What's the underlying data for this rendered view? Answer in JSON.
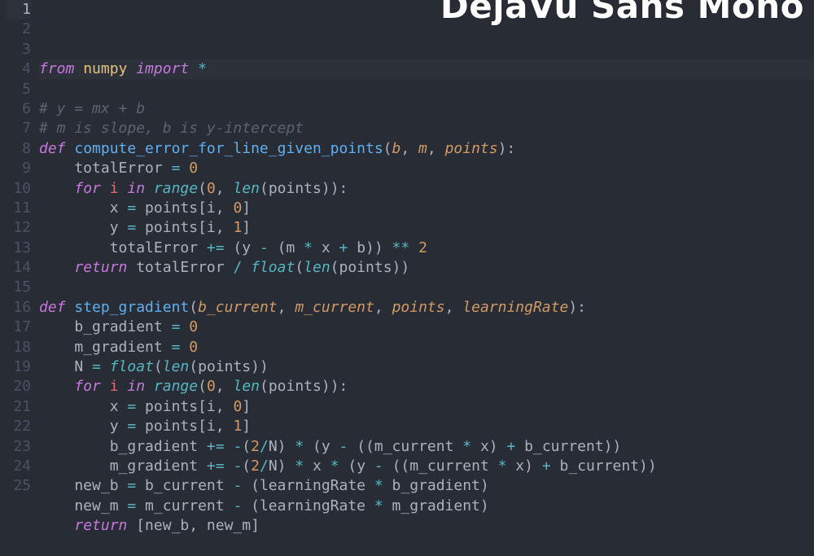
{
  "title_overlay": "DejaVu Sans Mono",
  "current_line": 1,
  "lines": [
    {
      "n": 1,
      "tokens": [
        {
          "t": "from ",
          "c": "kw"
        },
        {
          "t": "numpy",
          "c": "mod"
        },
        {
          "t": " ",
          "c": "txt"
        },
        {
          "t": "import",
          "c": "kw"
        },
        {
          "t": " ",
          "c": "txt"
        },
        {
          "t": "*",
          "c": "op"
        }
      ]
    },
    {
      "n": 2,
      "tokens": [
        {
          "t": "",
          "c": "txt"
        }
      ]
    },
    {
      "n": 3,
      "tokens": [
        {
          "t": "# y = mx + b",
          "c": "cmt"
        }
      ]
    },
    {
      "n": 4,
      "tokens": [
        {
          "t": "# m is slope, b is y-intercept",
          "c": "cmt"
        }
      ]
    },
    {
      "n": 5,
      "tokens": [
        {
          "t": "def ",
          "c": "kw"
        },
        {
          "t": "compute_error_for_line_given_points",
          "c": "def"
        },
        {
          "t": "(",
          "c": "txt"
        },
        {
          "t": "b",
          "c": "prm"
        },
        {
          "t": ", ",
          "c": "txt"
        },
        {
          "t": "m",
          "c": "prm"
        },
        {
          "t": ", ",
          "c": "txt"
        },
        {
          "t": "points",
          "c": "prm"
        },
        {
          "t": "):",
          "c": "txt"
        }
      ]
    },
    {
      "n": 6,
      "tokens": [
        {
          "t": "    totalError ",
          "c": "txt"
        },
        {
          "t": "=",
          "c": "op"
        },
        {
          "t": " ",
          "c": "txt"
        },
        {
          "t": "0",
          "c": "num"
        }
      ]
    },
    {
      "n": 7,
      "tokens": [
        {
          "t": "    ",
          "c": "txt"
        },
        {
          "t": "for ",
          "c": "kw"
        },
        {
          "t": "i",
          "c": "w"
        },
        {
          "t": " ",
          "c": "txt"
        },
        {
          "t": "in ",
          "c": "kw"
        },
        {
          "t": "range",
          "c": "bi"
        },
        {
          "t": "(",
          "c": "txt"
        },
        {
          "t": "0",
          "c": "num"
        },
        {
          "t": ", ",
          "c": "txt"
        },
        {
          "t": "len",
          "c": "bi"
        },
        {
          "t": "(points)):",
          "c": "txt"
        }
      ]
    },
    {
      "n": 8,
      "tokens": [
        {
          "t": "        x ",
          "c": "txt"
        },
        {
          "t": "=",
          "c": "op"
        },
        {
          "t": " points[i, ",
          "c": "txt"
        },
        {
          "t": "0",
          "c": "num"
        },
        {
          "t": "]",
          "c": "txt"
        }
      ]
    },
    {
      "n": 9,
      "tokens": [
        {
          "t": "        y ",
          "c": "txt"
        },
        {
          "t": "=",
          "c": "op"
        },
        {
          "t": " points[i, ",
          "c": "txt"
        },
        {
          "t": "1",
          "c": "num"
        },
        {
          "t": "]",
          "c": "txt"
        }
      ]
    },
    {
      "n": 10,
      "tokens": [
        {
          "t": "        totalError ",
          "c": "txt"
        },
        {
          "t": "+=",
          "c": "op"
        },
        {
          "t": " (y ",
          "c": "txt"
        },
        {
          "t": "-",
          "c": "op"
        },
        {
          "t": " (m ",
          "c": "txt"
        },
        {
          "t": "*",
          "c": "op"
        },
        {
          "t": " x ",
          "c": "txt"
        },
        {
          "t": "+",
          "c": "op"
        },
        {
          "t": " b)) ",
          "c": "txt"
        },
        {
          "t": "**",
          "c": "op"
        },
        {
          "t": " ",
          "c": "txt"
        },
        {
          "t": "2",
          "c": "num"
        }
      ]
    },
    {
      "n": 11,
      "tokens": [
        {
          "t": "    ",
          "c": "txt"
        },
        {
          "t": "return ",
          "c": "kw"
        },
        {
          "t": "totalError ",
          "c": "txt"
        },
        {
          "t": "/",
          "c": "op"
        },
        {
          "t": " ",
          "c": "txt"
        },
        {
          "t": "float",
          "c": "bi"
        },
        {
          "t": "(",
          "c": "txt"
        },
        {
          "t": "len",
          "c": "bi"
        },
        {
          "t": "(points))",
          "c": "txt"
        }
      ]
    },
    {
      "n": 12,
      "tokens": [
        {
          "t": "",
          "c": "txt"
        }
      ]
    },
    {
      "n": 13,
      "tokens": [
        {
          "t": "def ",
          "c": "kw"
        },
        {
          "t": "step_gradient",
          "c": "def"
        },
        {
          "t": "(",
          "c": "txt"
        },
        {
          "t": "b_current",
          "c": "prm"
        },
        {
          "t": ", ",
          "c": "txt"
        },
        {
          "t": "m_current",
          "c": "prm"
        },
        {
          "t": ", ",
          "c": "txt"
        },
        {
          "t": "points",
          "c": "prm"
        },
        {
          "t": ", ",
          "c": "txt"
        },
        {
          "t": "learningRate",
          "c": "prm"
        },
        {
          "t": "):",
          "c": "txt"
        }
      ]
    },
    {
      "n": 14,
      "tokens": [
        {
          "t": "    b_gradient ",
          "c": "txt"
        },
        {
          "t": "=",
          "c": "op"
        },
        {
          "t": " ",
          "c": "txt"
        },
        {
          "t": "0",
          "c": "num"
        }
      ]
    },
    {
      "n": 15,
      "tokens": [
        {
          "t": "    m_gradient ",
          "c": "txt"
        },
        {
          "t": "=",
          "c": "op"
        },
        {
          "t": " ",
          "c": "txt"
        },
        {
          "t": "0",
          "c": "num"
        }
      ]
    },
    {
      "n": 16,
      "tokens": [
        {
          "t": "    N ",
          "c": "txt"
        },
        {
          "t": "=",
          "c": "op"
        },
        {
          "t": " ",
          "c": "txt"
        },
        {
          "t": "float",
          "c": "bi"
        },
        {
          "t": "(",
          "c": "txt"
        },
        {
          "t": "len",
          "c": "bi"
        },
        {
          "t": "(points))",
          "c": "txt"
        }
      ]
    },
    {
      "n": 17,
      "tokens": [
        {
          "t": "    ",
          "c": "txt"
        },
        {
          "t": "for ",
          "c": "kw"
        },
        {
          "t": "i",
          "c": "w"
        },
        {
          "t": " ",
          "c": "txt"
        },
        {
          "t": "in ",
          "c": "kw"
        },
        {
          "t": "range",
          "c": "bi"
        },
        {
          "t": "(",
          "c": "txt"
        },
        {
          "t": "0",
          "c": "num"
        },
        {
          "t": ", ",
          "c": "txt"
        },
        {
          "t": "len",
          "c": "bi"
        },
        {
          "t": "(points)):",
          "c": "txt"
        }
      ]
    },
    {
      "n": 18,
      "tokens": [
        {
          "t": "        x ",
          "c": "txt"
        },
        {
          "t": "=",
          "c": "op"
        },
        {
          "t": " points[i, ",
          "c": "txt"
        },
        {
          "t": "0",
          "c": "num"
        },
        {
          "t": "]",
          "c": "txt"
        }
      ]
    },
    {
      "n": 19,
      "tokens": [
        {
          "t": "        y ",
          "c": "txt"
        },
        {
          "t": "=",
          "c": "op"
        },
        {
          "t": " points[i, ",
          "c": "txt"
        },
        {
          "t": "1",
          "c": "num"
        },
        {
          "t": "]",
          "c": "txt"
        }
      ]
    },
    {
      "n": 20,
      "tokens": [
        {
          "t": "        b_gradient ",
          "c": "txt"
        },
        {
          "t": "+=",
          "c": "op"
        },
        {
          "t": " ",
          "c": "txt"
        },
        {
          "t": "-",
          "c": "op"
        },
        {
          "t": "(",
          "c": "txt"
        },
        {
          "t": "2",
          "c": "num"
        },
        {
          "t": "/",
          "c": "op"
        },
        {
          "t": "N) ",
          "c": "txt"
        },
        {
          "t": "*",
          "c": "op"
        },
        {
          "t": " (y ",
          "c": "txt"
        },
        {
          "t": "-",
          "c": "op"
        },
        {
          "t": " ((m_current ",
          "c": "txt"
        },
        {
          "t": "*",
          "c": "op"
        },
        {
          "t": " x) ",
          "c": "txt"
        },
        {
          "t": "+",
          "c": "op"
        },
        {
          "t": " b_current))",
          "c": "txt"
        }
      ]
    },
    {
      "n": 21,
      "tokens": [
        {
          "t": "        m_gradient ",
          "c": "txt"
        },
        {
          "t": "+=",
          "c": "op"
        },
        {
          "t": " ",
          "c": "txt"
        },
        {
          "t": "-",
          "c": "op"
        },
        {
          "t": "(",
          "c": "txt"
        },
        {
          "t": "2",
          "c": "num"
        },
        {
          "t": "/",
          "c": "op"
        },
        {
          "t": "N) ",
          "c": "txt"
        },
        {
          "t": "*",
          "c": "op"
        },
        {
          "t": " x ",
          "c": "txt"
        },
        {
          "t": "*",
          "c": "op"
        },
        {
          "t": " (y ",
          "c": "txt"
        },
        {
          "t": "-",
          "c": "op"
        },
        {
          "t": " ((m_current ",
          "c": "txt"
        },
        {
          "t": "*",
          "c": "op"
        },
        {
          "t": " x) ",
          "c": "txt"
        },
        {
          "t": "+",
          "c": "op"
        },
        {
          "t": " b_current))",
          "c": "txt"
        }
      ]
    },
    {
      "n": 22,
      "tokens": [
        {
          "t": "    new_b ",
          "c": "txt"
        },
        {
          "t": "=",
          "c": "op"
        },
        {
          "t": " b_current ",
          "c": "txt"
        },
        {
          "t": "-",
          "c": "op"
        },
        {
          "t": " (learningRate ",
          "c": "txt"
        },
        {
          "t": "*",
          "c": "op"
        },
        {
          "t": " b_gradient)",
          "c": "txt"
        }
      ]
    },
    {
      "n": 23,
      "tokens": [
        {
          "t": "    new_m ",
          "c": "txt"
        },
        {
          "t": "=",
          "c": "op"
        },
        {
          "t": " m_current ",
          "c": "txt"
        },
        {
          "t": "-",
          "c": "op"
        },
        {
          "t": " (learningRate ",
          "c": "txt"
        },
        {
          "t": "*",
          "c": "op"
        },
        {
          "t": " m_gradient)",
          "c": "txt"
        }
      ]
    },
    {
      "n": 24,
      "tokens": [
        {
          "t": "    ",
          "c": "txt"
        },
        {
          "t": "return ",
          "c": "kw"
        },
        {
          "t": "[new_b, new_m]",
          "c": "txt"
        }
      ]
    },
    {
      "n": 25,
      "tokens": [
        {
          "t": "",
          "c": "txt"
        }
      ]
    }
  ]
}
